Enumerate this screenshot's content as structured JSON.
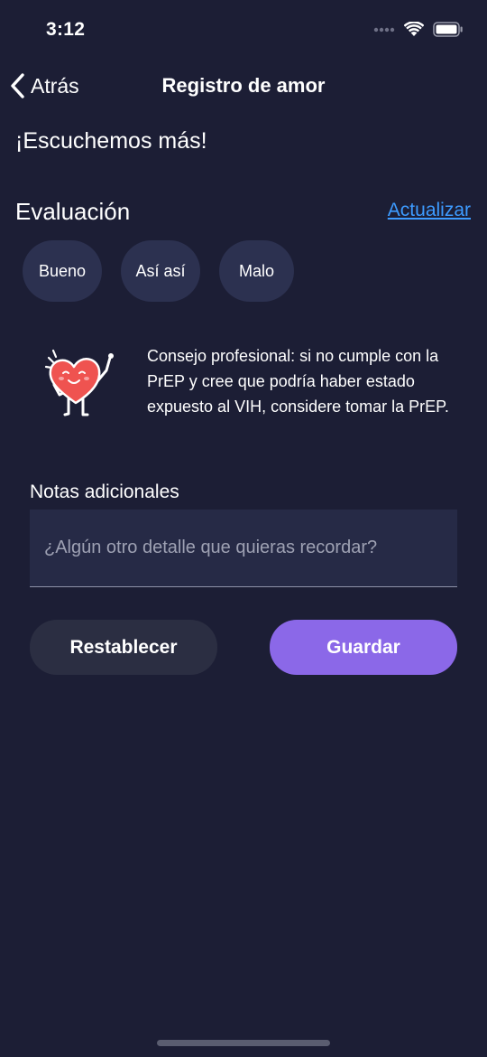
{
  "status_bar": {
    "time": "3:12",
    "icons": [
      "cellular-dots-icon",
      "wifi-icon",
      "battery-icon"
    ]
  },
  "nav": {
    "back_label": "Atrás",
    "title": "Registro de amor"
  },
  "main": {
    "heading": "¡Escuchemos más!",
    "rating": {
      "label": "Evaluación",
      "update_link": "Actualizar",
      "options": [
        "Bueno",
        "Así así",
        "Malo"
      ]
    },
    "tip": {
      "icon": "heart-mascot-icon",
      "text": "Consejo profesional: si no cumple con la PrEP y cree que podría haber estado expuesto al VIH, considere tomar la PrEP."
    },
    "notes": {
      "label": "Notas adicionales",
      "placeholder": "¿Algún otro detalle que quieras recordar?"
    },
    "actions": {
      "reset_label": "Restablecer",
      "save_label": "Guardar"
    }
  },
  "colors": {
    "background": "#1c1e35",
    "chip": "#2c3150",
    "link": "#3d9bff",
    "primary_button": "#8b68e8",
    "secondary_button": "#2b2e42",
    "heart": "#ef5350"
  }
}
